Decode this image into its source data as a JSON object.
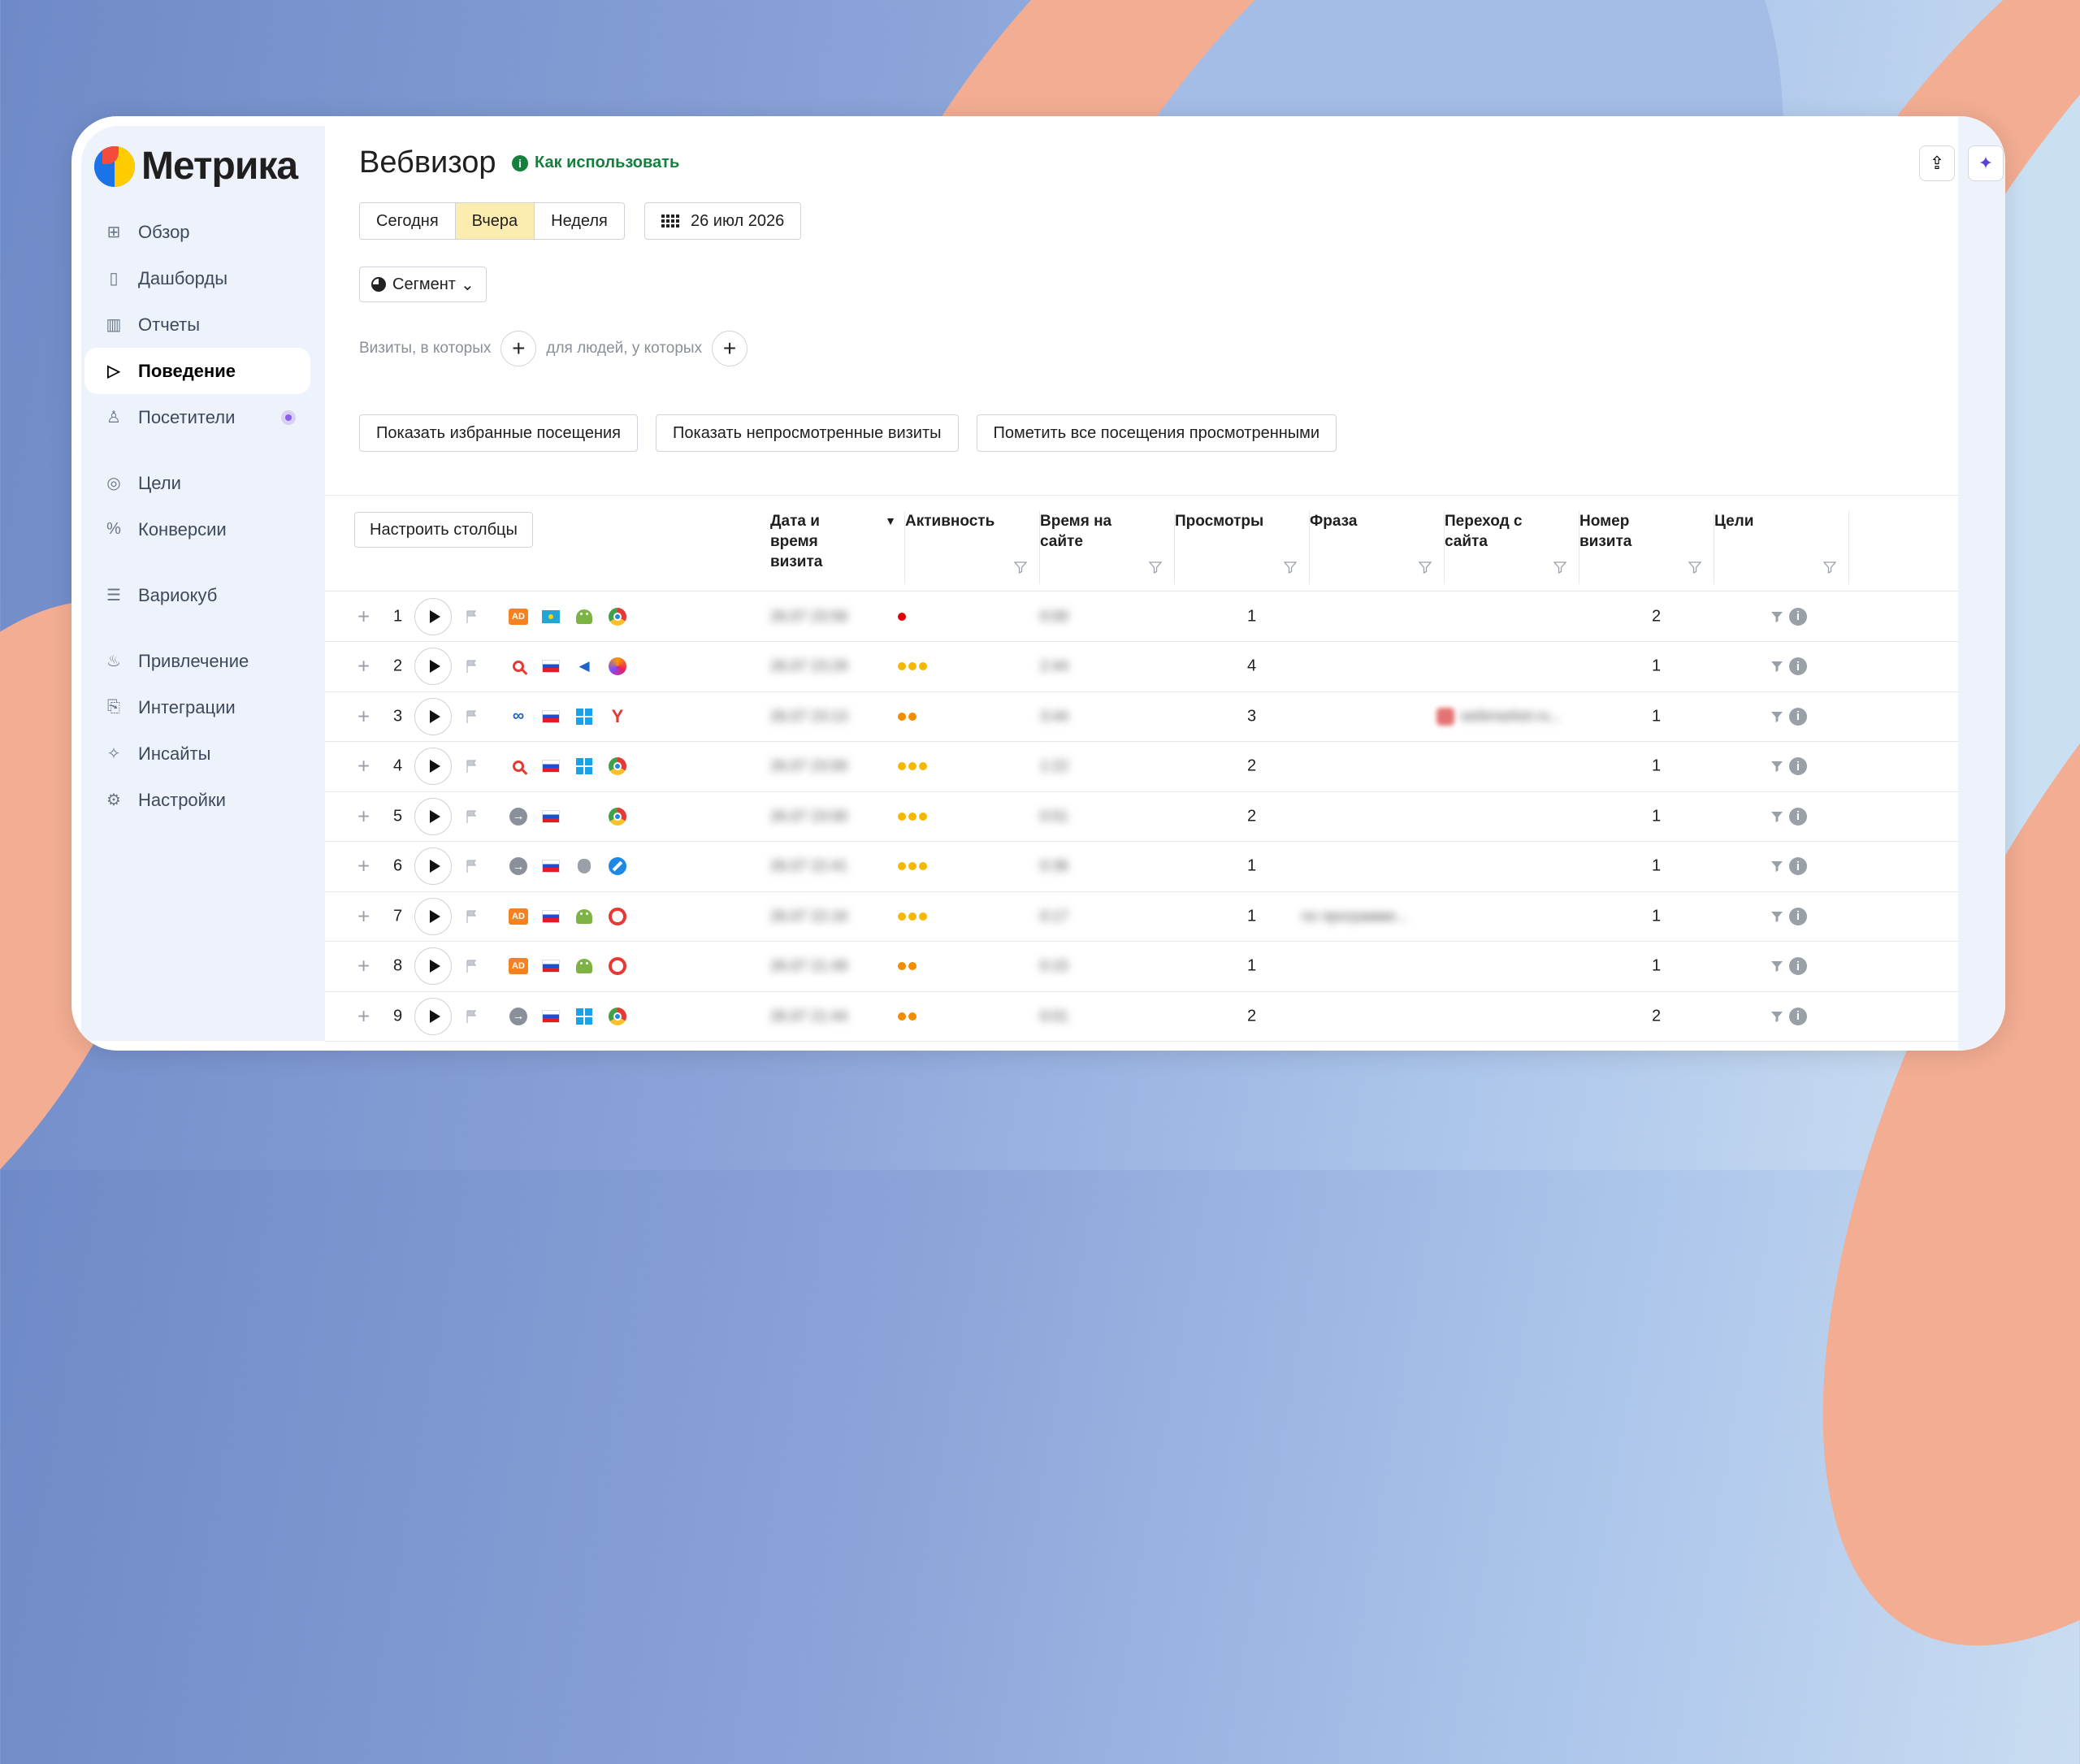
{
  "app": {
    "logo_text": "Метрика"
  },
  "sidebar": {
    "items": [
      {
        "label": "Обзор",
        "icon": "grid-icon",
        "glyph": "⊞"
      },
      {
        "label": "Дашборды",
        "icon": "dashboards-icon",
        "glyph": "▯"
      },
      {
        "label": "Отчеты",
        "icon": "bar-chart-icon",
        "glyph": "▥"
      },
      {
        "label": "Поведение",
        "icon": "play-outline-icon",
        "glyph": "▷",
        "active": true
      },
      {
        "label": "Посетители",
        "icon": "person-icon",
        "glyph": "♙"
      },
      {
        "label": "Цели",
        "icon": "target-icon",
        "glyph": "◎"
      },
      {
        "label": "Конверсии",
        "icon": "percent-icon",
        "glyph": "%"
      },
      {
        "label": "Вариокуб",
        "icon": "cube-icon",
        "glyph": "☰"
      },
      {
        "label": "Привлечение",
        "icon": "flame-icon",
        "glyph": "♨"
      },
      {
        "label": "Интеграции",
        "icon": "puzzle-icon",
        "glyph": "⎘"
      },
      {
        "label": "Инсайты",
        "icon": "sparkle-icon",
        "glyph": "✧"
      },
      {
        "label": "Настройки",
        "icon": "gear-icon",
        "glyph": "⚙"
      }
    ]
  },
  "header": {
    "title": "Вебвизор",
    "howto_label": "Как использовать",
    "howto_glyph": "i",
    "period_tabs": [
      "Сегодня",
      "Вчера",
      "Неделя"
    ],
    "selected_period": "Вчера",
    "date_label": "26 июл 2026",
    "segment_label": "Сегмент",
    "segment_caret": "⌄",
    "share_glyph": "⇪",
    "assistant_glyph": "✦"
  },
  "filters": {
    "visits_label": "Визиты, в которых",
    "people_label": "для людей, у которых",
    "plus_glyph": "+"
  },
  "actions": {
    "show_favorites": "Показать избранные посещения",
    "show_unviewed": "Показать непросмотренные визиты",
    "mark_all_viewed": "Пометить все посещения просмотренными"
  },
  "table": {
    "configure_columns": "Настроить столбцы",
    "sort_glyph": "▼",
    "columns": [
      "Дата и время визита",
      "Активность",
      "Время на сайте",
      "Просмотры",
      "Фраза",
      "Переход с сайта",
      "Номер визита",
      "Цели"
    ],
    "row_plus": "+",
    "info_glyph": "i",
    "rows": [
      {
        "num": "1",
        "date": "26.07 23:56",
        "activity": 1,
        "activity_color": "#e00000",
        "time": "0:00",
        "views": "1",
        "phrase": "",
        "referrer": "",
        "visit_no": "2",
        "source": "ad",
        "country": "kz",
        "os": "android",
        "browser": "chrome"
      },
      {
        "num": "2",
        "date": "26.07 23:29",
        "activity": 3,
        "activity_color": "#f5b800",
        "time": "2:44",
        "views": "4",
        "phrase": "",
        "referrer": "",
        "visit_no": "1",
        "source": "search",
        "country": "ru",
        "os": "speaker",
        "browser": "firefox"
      },
      {
        "num": "3",
        "date": "26.07 23:13",
        "activity": 2,
        "activity_color": "#f28c00",
        "time": "3:44",
        "views": "3",
        "phrase": "",
        "referrer": "webmarket.ru...",
        "visit_no": "1",
        "source": "link",
        "country": "ru",
        "os": "windows",
        "browser": "yandex"
      },
      {
        "num": "4",
        "date": "26.07 23:00",
        "activity": 3,
        "activity_color": "#f5b800",
        "time": "1:22",
        "views": "2",
        "phrase": "",
        "referrer": "",
        "visit_no": "1",
        "source": "search",
        "country": "ru",
        "os": "windows",
        "browser": "chrome"
      },
      {
        "num": "5",
        "date": "26.07 23:00",
        "activity": 3,
        "activity_color": "#f5b800",
        "time": "0:51",
        "views": "2",
        "phrase": "",
        "referrer": "",
        "visit_no": "1",
        "source": "direct",
        "country": "ru",
        "os": "",
        "browser": "chrome"
      },
      {
        "num": "6",
        "date": "26.07 22:41",
        "activity": 3,
        "activity_color": "#f5b800",
        "time": "0:36",
        "views": "1",
        "phrase": "",
        "referrer": "",
        "visit_no": "1",
        "source": "direct",
        "country": "ru",
        "os": "apple",
        "browser": "safari"
      },
      {
        "num": "7",
        "date": "26.07 22:16",
        "activity": 3,
        "activity_color": "#f5b800",
        "time": "0:17",
        "views": "1",
        "phrase": "по программе...",
        "referrer": "",
        "visit_no": "1",
        "source": "ad",
        "country": "ru",
        "os": "android",
        "browser": "opera"
      },
      {
        "num": "8",
        "date": "26.07 21:49",
        "activity": 2,
        "activity_color": "#f28c00",
        "time": "0:15",
        "views": "1",
        "phrase": "",
        "referrer": "",
        "visit_no": "1",
        "source": "ad",
        "country": "ru",
        "os": "android",
        "browser": "opera"
      },
      {
        "num": "9",
        "date": "26.07 21:44",
        "activity": 2,
        "activity_color": "#f28c00",
        "time": "0:01",
        "views": "2",
        "phrase": "",
        "referrer": "",
        "visit_no": "2",
        "source": "direct",
        "country": "ru",
        "os": "windows",
        "browser": "chrome"
      }
    ]
  },
  "colors": {
    "accent_yellow": "#fdecaf",
    "green": "#15803d",
    "sidebar_bg": "#eef2fb"
  }
}
